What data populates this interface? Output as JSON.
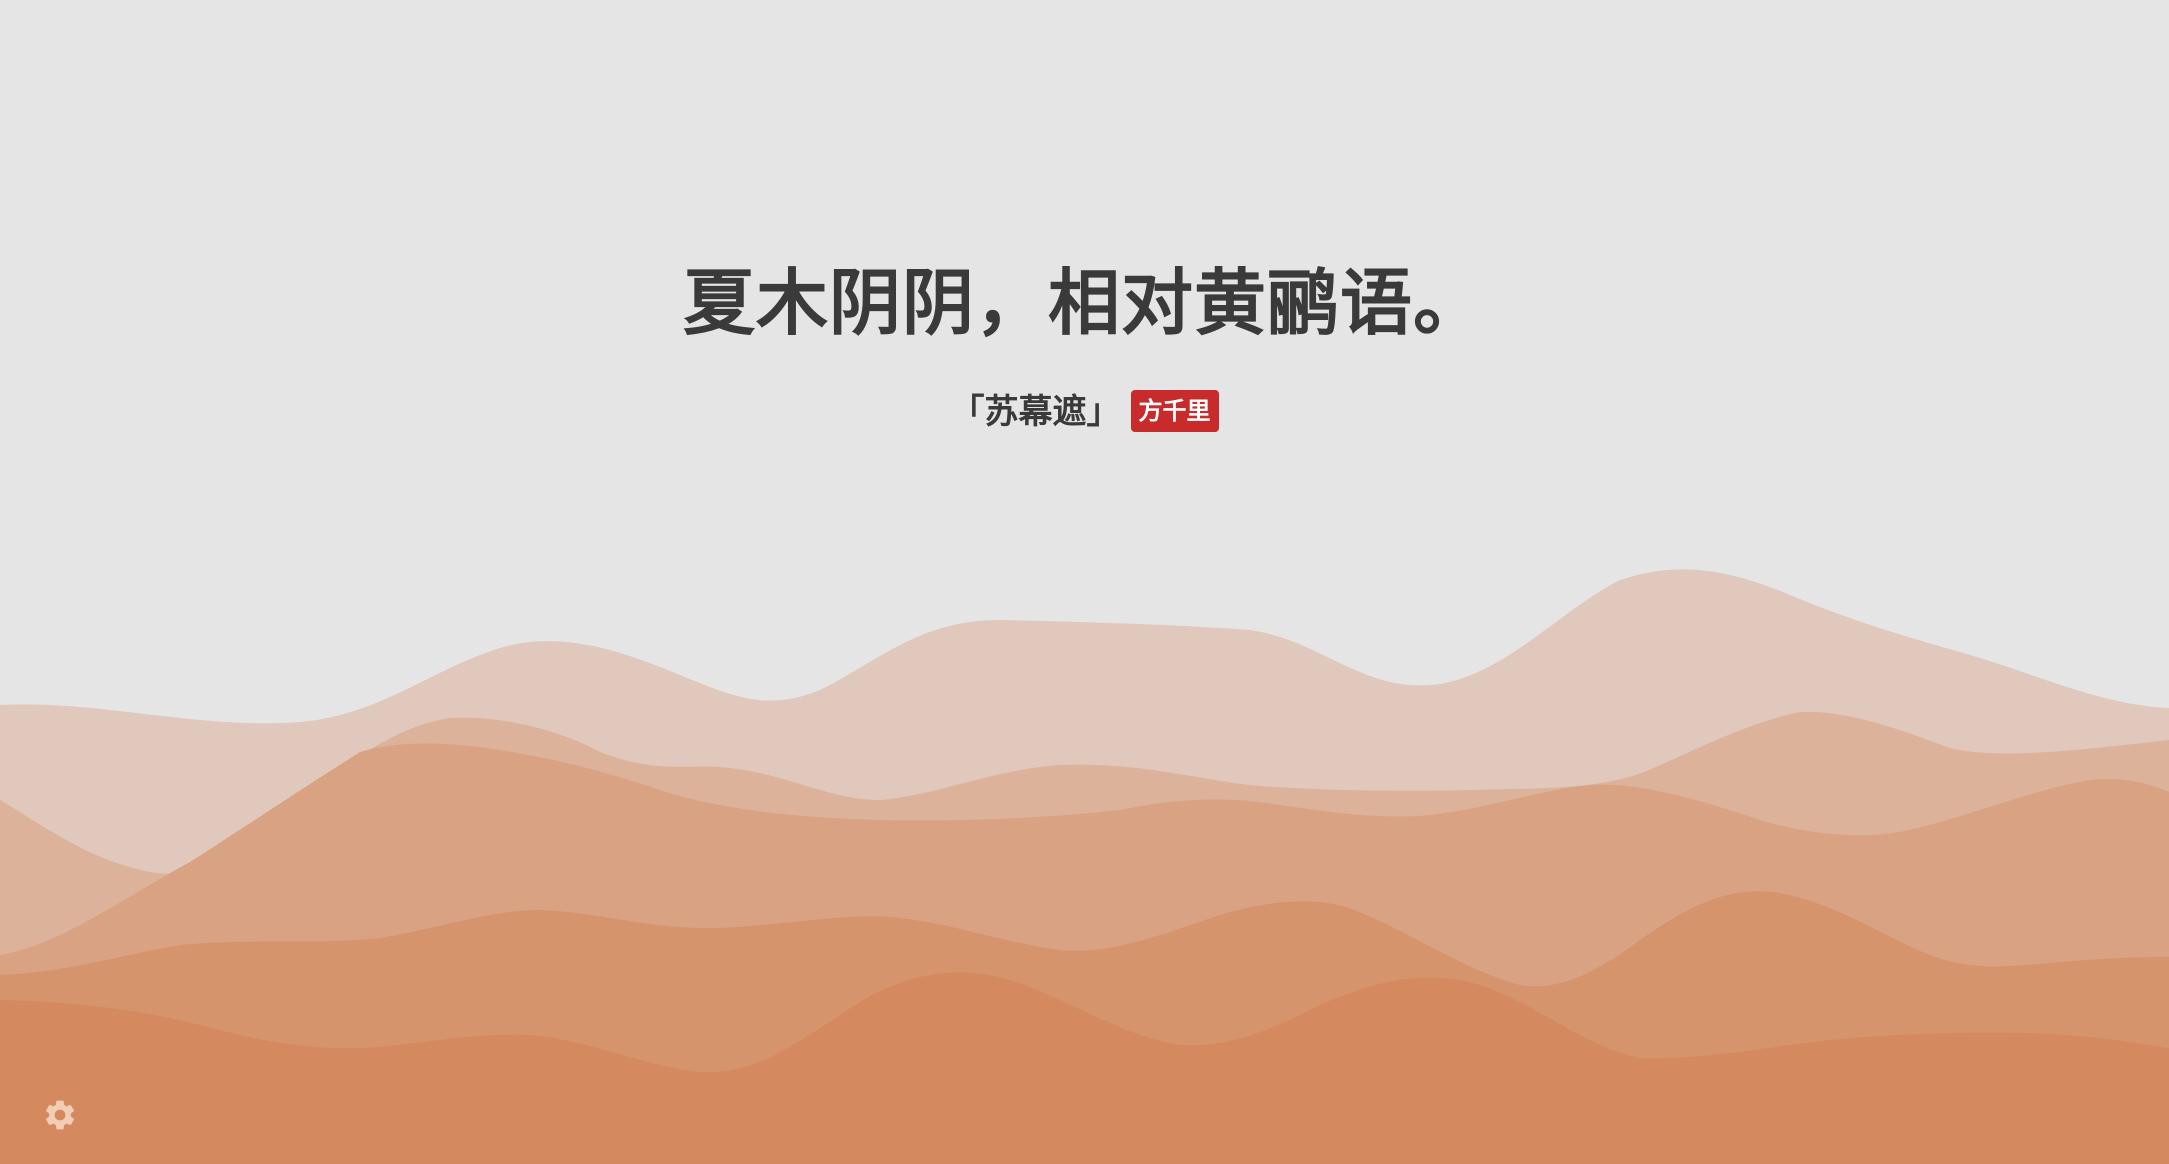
{
  "poem": {
    "line": "夏木阴阴，相对黄鹂语。",
    "title": "「苏幕遮」",
    "author": "方千里"
  },
  "colors": {
    "background": "#e5e5e5",
    "text": "#3a3a3a",
    "badge": "#c82b2b",
    "hill_1": "#e1c8bc",
    "hill_2": "#dcb29a",
    "hill_3": "#d9a282",
    "hill_4": "#d6946c",
    "hill_5": "#d48a5e",
    "settings_icon": "#f2cdb5"
  },
  "icons": {
    "settings": "gear-icon"
  }
}
